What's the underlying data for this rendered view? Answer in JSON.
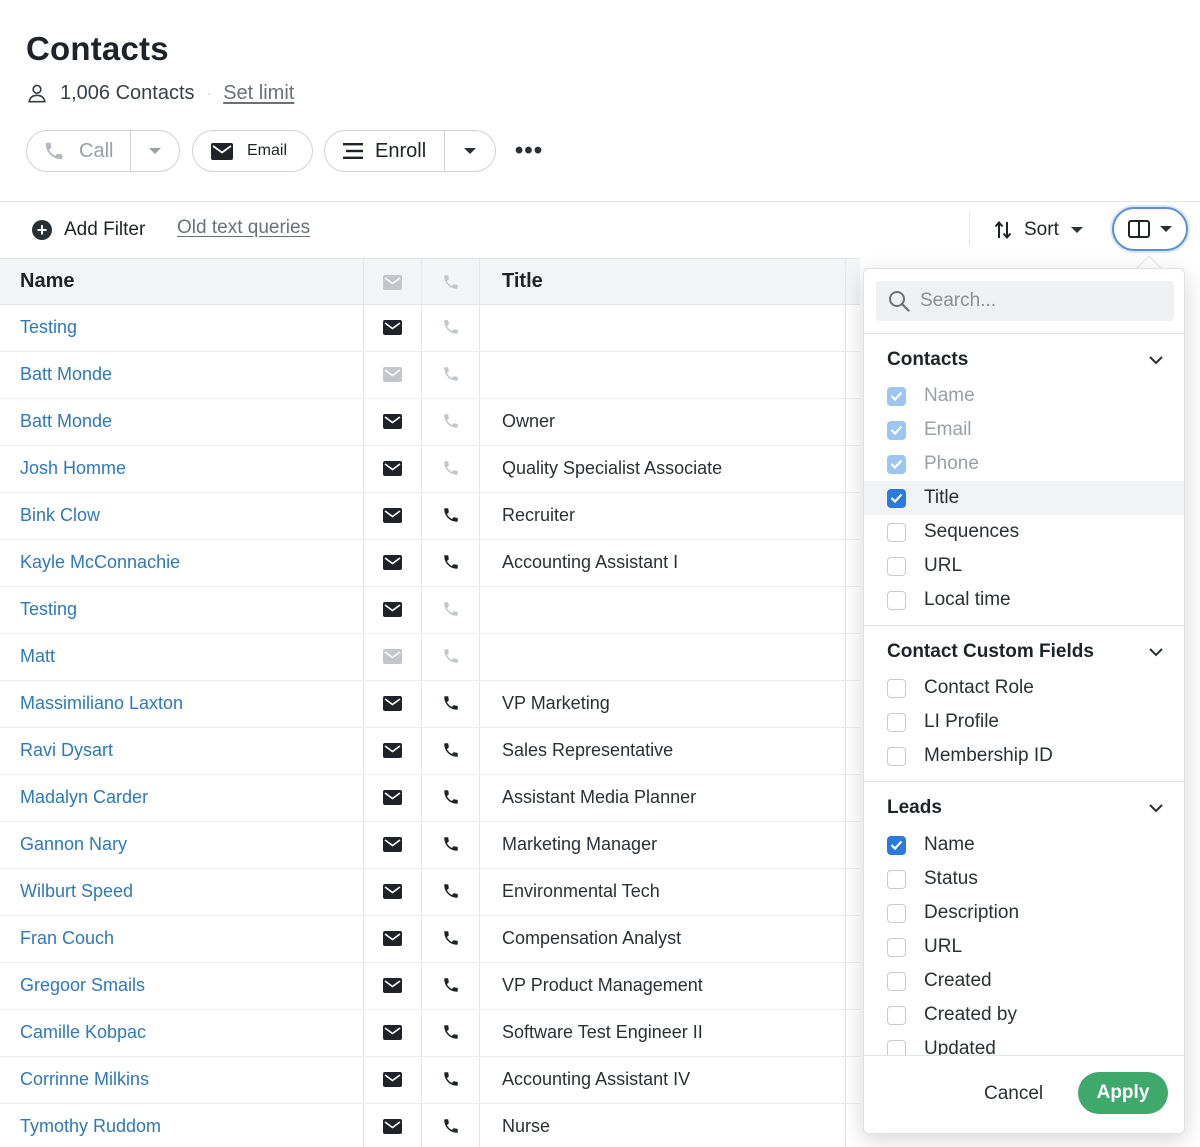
{
  "header": {
    "title": "Contacts",
    "count_label": "1,006 Contacts",
    "separator": "·",
    "set_limit": "Set limit"
  },
  "toolbar": {
    "call_label": "Call",
    "email_label": "Email",
    "enroll_label": "Enroll",
    "more_label": "•••"
  },
  "filter_bar": {
    "add_filter": "Add Filter",
    "old_text_queries": "Old text queries",
    "sort_label": "Sort"
  },
  "table": {
    "columns": {
      "name": "Name",
      "title": "Title"
    },
    "rows": [
      {
        "name": "Testing",
        "email": true,
        "phone": false,
        "title": ""
      },
      {
        "name": "Batt Monde",
        "email": false,
        "phone": false,
        "title": ""
      },
      {
        "name": "Batt Monde",
        "email": true,
        "phone": false,
        "title": "Owner"
      },
      {
        "name": "Josh Homme",
        "email": true,
        "phone": false,
        "title": "Quality Specialist Associate"
      },
      {
        "name": "Bink Clow",
        "email": true,
        "phone": true,
        "title": "Recruiter"
      },
      {
        "name": "Kayle McConnachie",
        "email": true,
        "phone": true,
        "title": "Accounting Assistant I"
      },
      {
        "name": "Testing",
        "email": true,
        "phone": false,
        "title": ""
      },
      {
        "name": "Matt",
        "email": false,
        "phone": false,
        "title": ""
      },
      {
        "name": "Massimiliano Laxton",
        "email": true,
        "phone": true,
        "title": "VP Marketing"
      },
      {
        "name": "Ravi Dysart",
        "email": true,
        "phone": true,
        "title": "Sales Representative"
      },
      {
        "name": "Madalyn Carder",
        "email": true,
        "phone": true,
        "title": "Assistant Media Planner"
      },
      {
        "name": "Gannon Nary",
        "email": true,
        "phone": true,
        "title": "Marketing Manager"
      },
      {
        "name": "Wilburt Speed",
        "email": true,
        "phone": true,
        "title": "Environmental Tech"
      },
      {
        "name": "Fran Couch",
        "email": true,
        "phone": true,
        "title": "Compensation Analyst"
      },
      {
        "name": "Gregoor Smails",
        "email": true,
        "phone": true,
        "title": "VP Product Management"
      },
      {
        "name": "Camille Kobpac",
        "email": true,
        "phone": true,
        "title": "Software Test Engineer II"
      },
      {
        "name": "Corrinne Milkins",
        "email": true,
        "phone": true,
        "title": "Accounting Assistant IV"
      },
      {
        "name": "Tymothy Ruddom",
        "email": true,
        "phone": true,
        "title": "Nurse"
      }
    ]
  },
  "columns_panel": {
    "search_placeholder": "Search...",
    "sections": [
      {
        "heading": "Contacts",
        "options": [
          {
            "label": "Name",
            "checked": true,
            "disabled": true
          },
          {
            "label": "Email",
            "checked": true,
            "disabled": true
          },
          {
            "label": "Phone",
            "checked": true,
            "disabled": true
          },
          {
            "label": "Title",
            "checked": true,
            "disabled": false,
            "highlighted": true
          },
          {
            "label": "Sequences",
            "checked": false,
            "disabled": false
          },
          {
            "label": "URL",
            "checked": false,
            "disabled": false
          },
          {
            "label": "Local time",
            "checked": false,
            "disabled": false
          }
        ]
      },
      {
        "heading": "Contact Custom Fields",
        "options": [
          {
            "label": "Contact Role",
            "checked": false,
            "disabled": false
          },
          {
            "label": "LI Profile",
            "checked": false,
            "disabled": false
          },
          {
            "label": "Membership ID",
            "checked": false,
            "disabled": false
          }
        ]
      },
      {
        "heading": "Leads",
        "options": [
          {
            "label": "Name",
            "checked": true,
            "disabled": false
          },
          {
            "label": "Status",
            "checked": false,
            "disabled": false
          },
          {
            "label": "Description",
            "checked": false,
            "disabled": false
          },
          {
            "label": "URL",
            "checked": false,
            "disabled": false
          },
          {
            "label": "Created",
            "checked": false,
            "disabled": false
          },
          {
            "label": "Created by",
            "checked": false,
            "disabled": false
          },
          {
            "label": "Updated",
            "checked": false,
            "disabled": false
          }
        ]
      }
    ],
    "cancel_label": "Cancel",
    "apply_label": "Apply"
  },
  "colors": {
    "link_blue": "#2f79b6",
    "checkbox_blue": "#2b7bdc",
    "apply_green": "#3ea96b",
    "focus_ring": "#5b8fd0"
  }
}
